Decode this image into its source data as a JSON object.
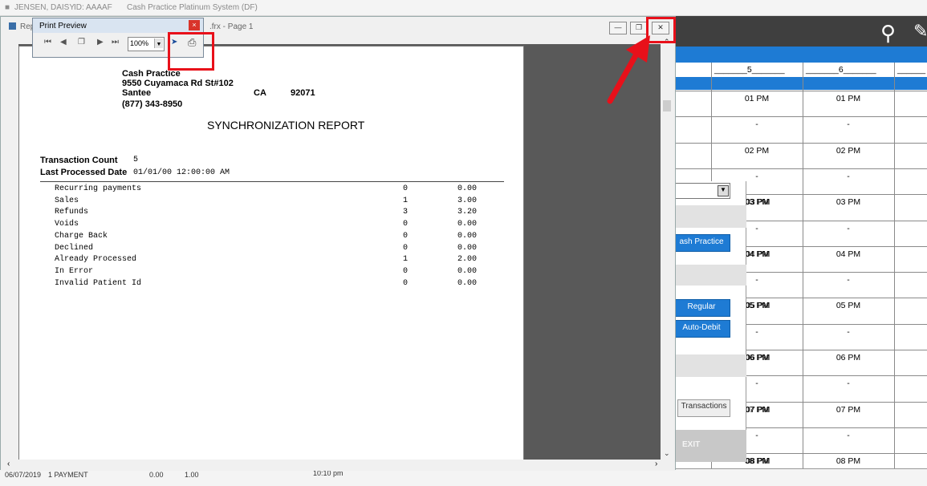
{
  "app_title": {
    "patient": "JENSEN, DAISY",
    "id": "ID: AAAAF",
    "system": "Cash Practice  Platinum System (DF)"
  },
  "report_window": {
    "title_left": "Rep",
    "title_right": ".frx - Page 1"
  },
  "print_preview": {
    "title": "Print Preview",
    "zoom": "100%"
  },
  "report": {
    "practice_name": "Cash Practice",
    "address": "9550 Cuyamaca Rd St#102",
    "city": "Santee",
    "state": "CA",
    "zip": "92071",
    "phone": "(877) 343-8950",
    "title": "SYNCHRONIZATION REPORT",
    "transaction_count_label": "Transaction Count",
    "transaction_count": "5",
    "last_processed_label": "Last Processed Date",
    "last_processed": "01/01/00 12:00:00 AM",
    "rows": [
      {
        "label": "Recurring payments",
        "count": "0",
        "amount": "0.00"
      },
      {
        "label": "Sales",
        "count": "1",
        "amount": "3.00"
      },
      {
        "label": "Refunds",
        "count": "3",
        "amount": "3.20"
      },
      {
        "label": "Voids",
        "count": "0",
        "amount": "0.00"
      },
      {
        "label": "Charge Back",
        "count": "0",
        "amount": "0.00"
      },
      {
        "label": "Declined",
        "count": "0",
        "amount": "0.00"
      },
      {
        "label": "Already Processed",
        "count": "1",
        "amount": "2.00"
      },
      {
        "label": "In Error",
        "count": "0",
        "amount": "0.00"
      },
      {
        "label": "Invalid Patient Id",
        "count": "0",
        "amount": "0.00"
      }
    ]
  },
  "schedule": {
    "col_headers": [
      "5",
      "6"
    ],
    "times": [
      "01 PM",
      "-",
      "02 PM",
      "-",
      "03 PM",
      "-",
      "04 PM",
      "-",
      "05 PM",
      "-",
      "06 PM",
      "-",
      "07 PM",
      "-",
      "08 PM"
    ],
    "left_times": [
      "03 PM",
      "04 PM",
      "05 PM",
      "06 PM",
      "07 PM",
      "08 PM"
    ]
  },
  "side_panel": {
    "practice_button": "ash Practice",
    "regular_button": "Regular",
    "auto_debit_button": "Auto-Debit",
    "transactions_button": "Transactions",
    "exit_label": "EXIT"
  },
  "bottom_strip": {
    "date": "06/07/2019",
    "type": "1 PAYMENT",
    "amount1": "0.00",
    "amount2": "1.00",
    "time": "10:10 pm"
  },
  "colors": {
    "accent_blue": "#1e7bd4",
    "annotation_red": "#e8101a"
  }
}
